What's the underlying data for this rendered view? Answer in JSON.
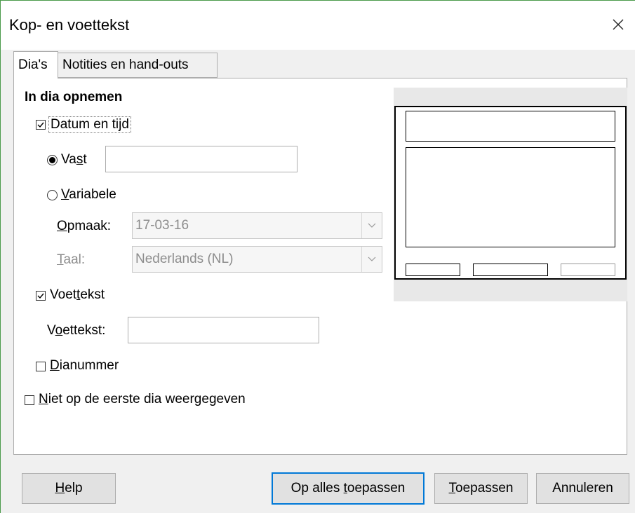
{
  "dialog": {
    "title": "Kop- en voettekst"
  },
  "tabs": [
    {
      "label": "Dia's",
      "active": true
    },
    {
      "label": "Notities en hand-outs",
      "active": false
    }
  ],
  "section": {
    "heading": "In dia opnemen"
  },
  "date_time": {
    "label": "Datum en tijd",
    "checked": true,
    "fixed": {
      "label": "Vast",
      "selected": true,
      "value": ""
    },
    "variable": {
      "label": "Variabele",
      "selected": false
    },
    "format": {
      "label": "Opmaak:",
      "value": "17-03-16"
    },
    "language": {
      "label": "Taal:",
      "value": "Nederlands (NL)"
    }
  },
  "footer": {
    "checkbox_label": "Voettekst",
    "checked": true,
    "field_label": "Voettekst:",
    "value": ""
  },
  "slide_number": {
    "label": "Dianummer",
    "checked": false
  },
  "not_first_slide": {
    "label": "Niet op de eerste dia weergegeven",
    "checked": false
  },
  "buttons": {
    "help": "Help",
    "apply_all": "Op alles toepassen",
    "apply": "Toepassen",
    "cancel": "Annuleren"
  },
  "icons": {
    "close": "close-icon",
    "dropdown": "chevron-down-icon"
  },
  "colors": {
    "default_button_border": "#0078d7",
    "window_border": "#4a9a4a",
    "preview_background": "#e8e8e8"
  }
}
